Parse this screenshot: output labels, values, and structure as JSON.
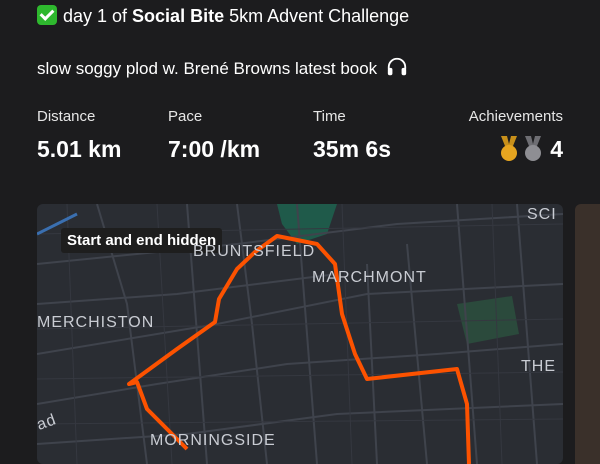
{
  "activity": {
    "title_prefix": "day 1 of ",
    "title_bold": "Social Bite",
    "title_suffix": " 5km Advent Challenge",
    "description": "slow soggy plod w. Brené Browns latest book",
    "headphones_icon": "headphones-icon",
    "check_icon": "check-mark-icon"
  },
  "stats": [
    {
      "label": "Distance",
      "value": "5.01 km"
    },
    {
      "label": "Pace",
      "value": "7:00 /km"
    },
    {
      "label": "Time",
      "value": "35m 6s"
    }
  ],
  "achievements": {
    "label": "Achievements",
    "count": "4",
    "medal_colors": [
      "#e6a520",
      "#8e8e93"
    ]
  },
  "map": {
    "badge": "Start and end hidden",
    "labels": {
      "bruntsfield": "BRUNTSFIELD",
      "marchmont": "MARCHMONT",
      "merchiston": "MERCHISTON",
      "morningside": "MORNINGSIDE",
      "the": "THE",
      "sci": "SCI",
      "road": "ad"
    },
    "route_color": "#fc5200"
  }
}
